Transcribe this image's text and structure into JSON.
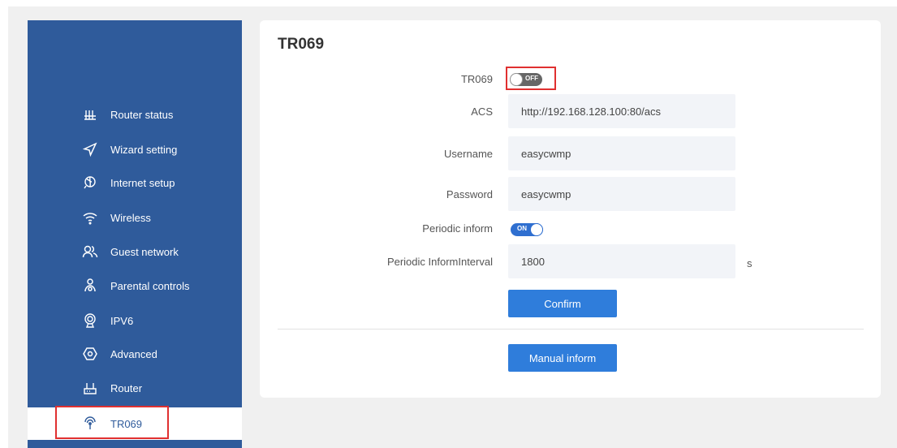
{
  "sidebar": {
    "items": [
      {
        "label": "Router status",
        "icon": "router-status-icon"
      },
      {
        "label": "Wizard setting",
        "icon": "send-icon"
      },
      {
        "label": "Internet setup",
        "icon": "globe-icon"
      },
      {
        "label": "Wireless",
        "icon": "wifi-icon"
      },
      {
        "label": "Guest network",
        "icon": "users-icon"
      },
      {
        "label": "Parental controls",
        "icon": "family-icon"
      },
      {
        "label": "IPV6",
        "icon": "ipv6-icon"
      },
      {
        "label": "Advanced",
        "icon": "hexagon-icon"
      },
      {
        "label": "Router",
        "icon": "router-icon"
      },
      {
        "label": "TR069",
        "icon": "tr069-icon",
        "active": true
      }
    ]
  },
  "main": {
    "title": "TR069",
    "tr069": {
      "label": "TR069",
      "state": "OFF"
    },
    "acs": {
      "label": "ACS",
      "value": "http://192.168.128.100:80/acs"
    },
    "username": {
      "label": "Username",
      "value": "easycwmp"
    },
    "password": {
      "label": "Password",
      "value": "easycwmp"
    },
    "periodic_inform": {
      "label": "Periodic inform",
      "state": "ON"
    },
    "interval": {
      "label": "Periodic InformInterval",
      "value": "1800",
      "unit": "s"
    },
    "confirm_label": "Confirm",
    "manual_inform_label": "Manual inform"
  },
  "colors": {
    "sidebar": "#2f5b9b",
    "button": "#2f7ddb",
    "toggle_on": "#2f6fd0",
    "toggle_off": "#666666",
    "highlight": "#e03030"
  }
}
